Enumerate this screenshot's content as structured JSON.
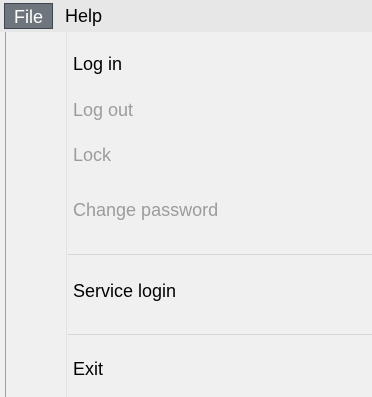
{
  "menubar": {
    "items": [
      {
        "label": "File"
      },
      {
        "label": "Help"
      }
    ]
  },
  "file_menu": {
    "items": [
      {
        "label": "Log in",
        "enabled": true
      },
      {
        "label": "Log out",
        "enabled": false
      },
      {
        "label": "Lock",
        "enabled": false
      },
      {
        "label": "Change password",
        "enabled": false
      },
      {
        "label": "Service login",
        "enabled": true
      },
      {
        "label": "Exit",
        "enabled": true
      }
    ]
  }
}
